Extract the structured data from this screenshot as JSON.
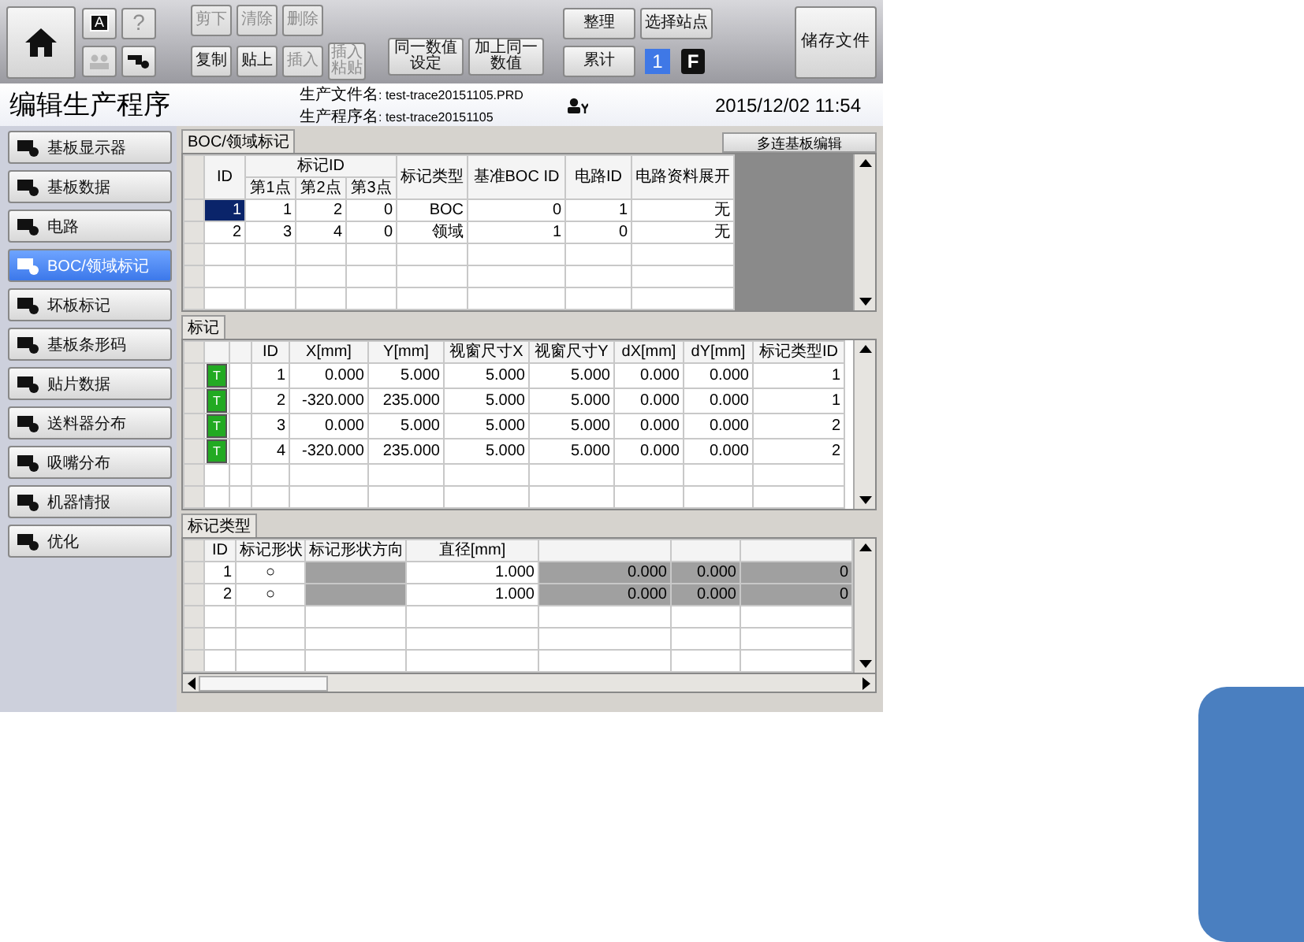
{
  "toolbar": {
    "font_button": "A",
    "help_button": {
      "label": "?",
      "disabled": true
    },
    "small_buttons": [
      {
        "kind": "people",
        "disabled": true
      },
      {
        "kind": "tool",
        "disabled": false
      }
    ],
    "edit_rows": [
      [
        {
          "label": "剪下",
          "disabled": true
        },
        {
          "label": "清除",
          "disabled": true
        },
        {
          "label": "删除",
          "disabled": true
        }
      ],
      [
        {
          "label": "复制",
          "disabled": false
        },
        {
          "label": "贴上",
          "disabled": false
        },
        {
          "label": "插入",
          "disabled": true
        },
        {
          "label": "插入粘贴",
          "disabled": true
        }
      ]
    ],
    "value_buttons": [
      "同一数值设定",
      "加上同一数值"
    ],
    "organize_button": "整理",
    "station_button": "选择站点",
    "total_button": "累计",
    "station_number": "1",
    "mode_badge": "F",
    "save_button": "储存文件"
  },
  "header": {
    "title": "编辑生产程序",
    "file_label": "生产文件名",
    "file_name": ": test-trace20151105.PRD",
    "program_label": "生产程序名",
    "program_name": ": test-trace20151105",
    "datetime": "2015/12/02 11:54"
  },
  "sidebar": {
    "items": [
      {
        "label": "基板显示器",
        "selected": false
      },
      {
        "label": "基板数据",
        "selected": false
      },
      {
        "label": "电路",
        "selected": false
      },
      {
        "label": "BOC/领域标记",
        "selected": true
      },
      {
        "label": "坏板标记",
        "selected": false
      },
      {
        "label": "基板条形码",
        "selected": false
      },
      {
        "label": "贴片数据",
        "selected": false
      },
      {
        "label": "送料器分布",
        "selected": false
      },
      {
        "label": "吸嘴分布",
        "selected": false
      },
      {
        "label": "机器情报",
        "selected": false
      },
      {
        "label": "优化",
        "selected": false
      }
    ]
  },
  "boc_panel": {
    "tab": "BOC/领域标记",
    "multi_edit_button": "多连基板编辑",
    "column_group": "标记ID",
    "columns": [
      "ID",
      "第1点",
      "第2点",
      "第3点",
      "标记类型",
      "基准BOC ID",
      "电路ID",
      "电路资料展开"
    ],
    "rows": [
      {
        "selected": true,
        "cells": [
          "1",
          "1",
          "2",
          "0",
          "BOC",
          "0",
          "1",
          "无"
        ]
      },
      {
        "selected": false,
        "cells": [
          "2",
          "3",
          "4",
          "0",
          "领域",
          "1",
          "0",
          "无"
        ]
      }
    ]
  },
  "mark_panel": {
    "tab": "标记",
    "columns": [
      "ID",
      "X[mm]",
      "Y[mm]",
      "视窗尺寸X",
      "视窗尺寸Y",
      "dX[mm]",
      "dY[mm]",
      "标记类型ID"
    ],
    "rows": [
      {
        "tag": "T",
        "cells": [
          "1",
          "0.000",
          "5.000",
          "5.000",
          "5.000",
          "0.000",
          "0.000",
          "1"
        ]
      },
      {
        "tag": "T",
        "cells": [
          "2",
          "-320.000",
          "235.000",
          "5.000",
          "5.000",
          "0.000",
          "0.000",
          "1"
        ]
      },
      {
        "tag": "T",
        "cells": [
          "3",
          "0.000",
          "5.000",
          "5.000",
          "5.000",
          "0.000",
          "0.000",
          "2"
        ]
      },
      {
        "tag": "T",
        "cells": [
          "4",
          "-320.000",
          "235.000",
          "5.000",
          "5.000",
          "0.000",
          "0.000",
          "2"
        ]
      }
    ]
  },
  "mark_type_panel": {
    "tab": "标记类型",
    "columns": [
      {
        "label": "ID",
        "disabled": false
      },
      {
        "label": "标记形状",
        "disabled": false
      },
      {
        "label": "标记形状方向",
        "disabled": true
      },
      {
        "label": "直径[mm]",
        "disabled": false
      },
      {
        "disabled": true
      },
      {
        "disabled": true
      },
      {
        "disabled": true
      }
    ],
    "rows": [
      {
        "cells": [
          "1",
          "○",
          null,
          "1.000",
          "0.000",
          "0.000",
          "0"
        ]
      },
      {
        "cells": [
          "2",
          "○",
          null,
          "1.000",
          "0.000",
          "0.000",
          "0"
        ]
      }
    ]
  }
}
